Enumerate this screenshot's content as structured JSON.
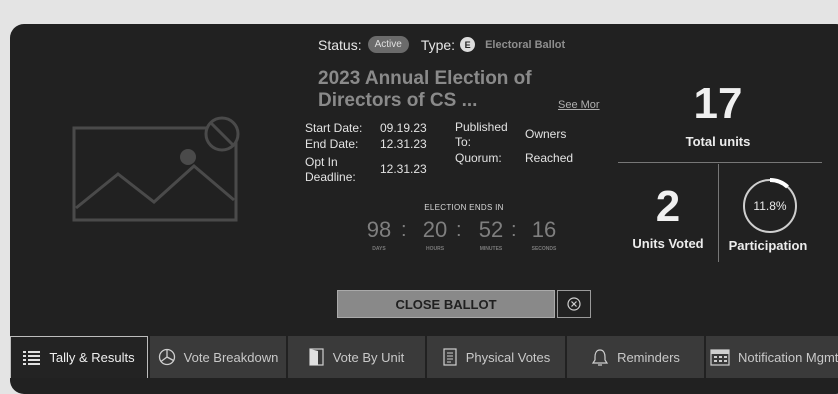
{
  "status": {
    "label": "Status:",
    "value": "Active"
  },
  "type": {
    "label": "Type:",
    "icon_letter": "E",
    "value": "Electoral Ballot"
  },
  "ballot": {
    "title": "2023 Annual Election of Directors of CS ...",
    "see_more": "See Mor"
  },
  "details": {
    "start_label": "Start Date:",
    "start_value": "09.19.23",
    "end_label": "End Date:",
    "end_value": "12.31.23",
    "optin_label": "Opt In Deadline:",
    "optin_value": "12.31.23",
    "published_label": "Published To:",
    "published_value": "Owners",
    "quorum_label": "Quorum:",
    "quorum_value": "Reached"
  },
  "countdown": {
    "title": "ELECTION ENDS IN",
    "days": "98",
    "hours": "20",
    "minutes": "52",
    "seconds": "16",
    "days_label": "DAYS",
    "hours_label": "HOURS",
    "minutes_label": "MINUTES",
    "seconds_label": "SECONDS",
    "separator": ":"
  },
  "stats": {
    "total_units": "17",
    "total_units_label": "Total units",
    "units_voted": "2",
    "units_voted_label": "Units Voted",
    "participation": "11.8%",
    "participation_label": "Participation",
    "participation_fraction": 0.118
  },
  "actions": {
    "close_ballot": "CLOSE BALLOT"
  },
  "tabs": [
    {
      "label": "Tally & Results",
      "icon": "list-icon",
      "active": true
    },
    {
      "label": "Vote Breakdown",
      "icon": "pie-chart-icon",
      "active": false
    },
    {
      "label": "Vote By Unit",
      "icon": "door-icon",
      "active": false
    },
    {
      "label": "Physical Votes",
      "icon": "ballot-paper-icon",
      "active": false
    },
    {
      "label": "Reminders",
      "icon": "bell-icon",
      "active": false
    },
    {
      "label": "Notification Mgmt",
      "icon": "calendar-icon",
      "active": false
    }
  ],
  "colors": {
    "card_bg": "#212121",
    "page_bg": "#e4e4e4",
    "tab_bg": "#3a3a3a",
    "button_bg": "#898989"
  }
}
